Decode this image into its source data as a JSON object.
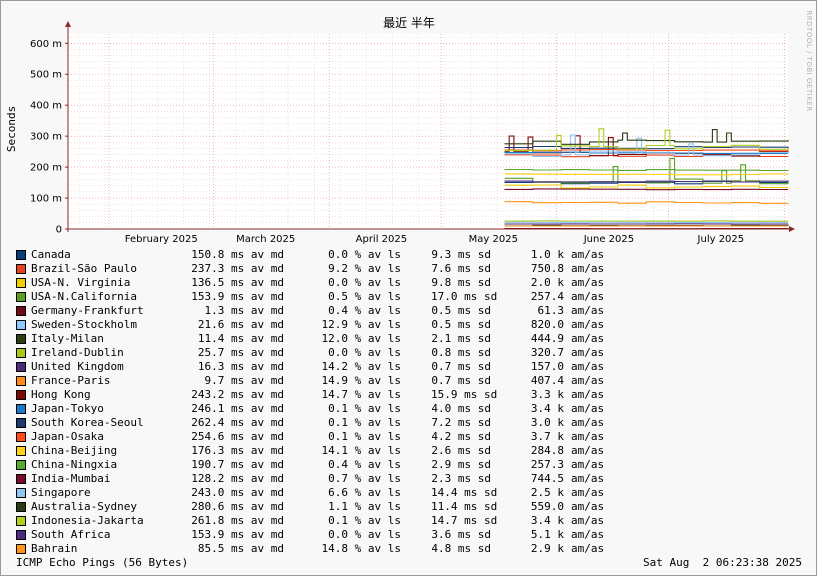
{
  "chart_data": {
    "type": "line",
    "title": "最近 半年",
    "ylabel": "Seconds",
    "ylim": [
      0,
      630
    ],
    "yticks": [
      {
        "value": 0,
        "label": "0"
      },
      {
        "value": 100,
        "label": "100 m"
      },
      {
        "value": 200,
        "label": "200 m"
      },
      {
        "value": 300,
        "label": "300 m"
      },
      {
        "value": 400,
        "label": "400 m"
      },
      {
        "value": 500,
        "label": "500 m"
      },
      {
        "value": 600,
        "label": "600 m"
      }
    ],
    "x_start": "2025-01-21",
    "x_end": "2025-08-02",
    "xticks": [
      {
        "date": "2025-02-15",
        "label": "February 2025"
      },
      {
        "date": "2025-03-15",
        "label": "March 2025"
      },
      {
        "date": "2025-04-15",
        "label": "April 2025"
      },
      {
        "date": "2025-05-15",
        "label": "May 2025"
      },
      {
        "date": "2025-06-15",
        "label": "June 2025"
      },
      {
        "date": "2025-07-15",
        "label": "July 2025"
      }
    ],
    "month_starts": [
      "2025-02-01",
      "2025-03-01",
      "2025-04-01",
      "2025-05-01",
      "2025-06-01",
      "2025-07-01",
      "2025-08-01"
    ],
    "data_start": "2025-05-18",
    "grid": true,
    "legend_position": "bottom",
    "series": [
      {
        "name": "Canada",
        "color": "#0a3d7c",
        "avg": "150.8 ms av md",
        "loss": "0.0 % av ls",
        "sd": "9.3 ms sd",
        "sent": "1.0 k",
        "unit": "am/as",
        "value": 150.8,
        "variation": 9.3
      },
      {
        "name": "Brazil-São Paulo",
        "color": "#e8421c",
        "avg": "237.3 ms av md",
        "loss": "9.2 % av ls",
        "sd": "7.6 ms sd",
        "sent": "750.8",
        "unit": "am/as",
        "value": 237.3,
        "variation": 7.6
      },
      {
        "name": "USA-N. Virginia",
        "color": "#f2d000",
        "avg": "136.5 ms av md",
        "loss": "0.0 % av ls",
        "sd": "9.8 ms sd",
        "sent": "2.0 k",
        "unit": "am/as",
        "value": 136.5,
        "variation": 9.8
      },
      {
        "name": "USA-N.California",
        "color": "#5a9e26",
        "avg": "153.9 ms av md",
        "loss": "0.5 % av ls",
        "sd": "17.0 ms sd",
        "sent": "257.4",
        "unit": "am/as",
        "value": 153.9,
        "variation": 17.0
      },
      {
        "name": "Germany-Frankfurt",
        "color": "#6e0b16",
        "avg": "1.3 ms av md",
        "loss": "0.4 % av ls",
        "sd": "0.5 ms sd",
        "sent": "61.3",
        "unit": "am/as",
        "value": 1.3,
        "variation": 0.5
      },
      {
        "name": "Sweden-Stockholm",
        "color": "#8cc8ff",
        "avg": "21.6 ms av md",
        "loss": "12.9 % av ls",
        "sd": "0.5 ms sd",
        "sent": "820.0",
        "unit": "am/as",
        "value": 21.6,
        "variation": 0.5
      },
      {
        "name": "Italy-Milan",
        "color": "#2e3c12",
        "avg": "11.4 ms av md",
        "loss": "12.0 % av ls",
        "sd": "2.1 ms sd",
        "sent": "444.9",
        "unit": "am/as",
        "value": 11.4,
        "variation": 2.1
      },
      {
        "name": "Ireland-Dublin",
        "color": "#a8c818",
        "avg": "25.7 ms av md",
        "loss": "0.0 % av ls",
        "sd": "0.8 ms sd",
        "sent": "320.7",
        "unit": "am/as",
        "value": 25.7,
        "variation": 0.8
      },
      {
        "name": "United Kingdom",
        "color": "#4a2a7a",
        "avg": "16.3 ms av md",
        "loss": "14.2 % av ls",
        "sd": "0.7 ms sd",
        "sent": "157.0",
        "unit": "am/as",
        "value": 16.3,
        "variation": 0.7
      },
      {
        "name": "France-Paris",
        "color": "#ff8c1a",
        "avg": "9.7 ms av md",
        "loss": "14.9 % av ls",
        "sd": "0.7 ms sd",
        "sent": "407.4",
        "unit": "am/as",
        "value": 9.7,
        "variation": 0.7
      },
      {
        "name": "Hong Kong",
        "color": "#7a0a0a",
        "avg": "243.2 ms av md",
        "loss": "14.7 % av ls",
        "sd": "15.9 ms sd",
        "sent": "3.3 k",
        "unit": "am/as",
        "value": 243.2,
        "variation": 15.9
      },
      {
        "name": "Japan-Tokyo",
        "color": "#1a7ac8",
        "avg": "246.1 ms av md",
        "loss": "0.1 % av ls",
        "sd": "4.0 ms sd",
        "sent": "3.4 k",
        "unit": "am/as",
        "value": 246.1,
        "variation": 4.0
      },
      {
        "name": "South Korea-Seoul",
        "color": "#1a3a6e",
        "avg": "262.4 ms av md",
        "loss": "0.1 % av ls",
        "sd": "7.2 ms sd",
        "sent": "3.0 k",
        "unit": "am/as",
        "value": 262.4,
        "variation": 7.2
      },
      {
        "name": "Japan-Osaka",
        "color": "#ff4a1a",
        "avg": "254.6 ms av md",
        "loss": "0.1 % av ls",
        "sd": "4.2 ms sd",
        "sent": "3.7 k",
        "unit": "am/as",
        "value": 254.6,
        "variation": 4.2
      },
      {
        "name": "China-Beijing",
        "color": "#ffd21a",
        "avg": "176.3 ms av md",
        "loss": "14.1 % av ls",
        "sd": "2.6 ms sd",
        "sent": "284.8",
        "unit": "am/as",
        "value": 176.3,
        "variation": 2.6
      },
      {
        "name": "China-Ningxia",
        "color": "#5aa832",
        "avg": "190.7 ms av md",
        "loss": "0.4 % av ls",
        "sd": "2.9 ms sd",
        "sent": "257.3",
        "unit": "am/as",
        "value": 190.7,
        "variation": 2.9
      },
      {
        "name": "India-Mumbai",
        "color": "#7a0a2a",
        "avg": "128.2 ms av md",
        "loss": "0.7 % av ls",
        "sd": "2.3 ms sd",
        "sent": "744.5",
        "unit": "am/as",
        "value": 128.2,
        "variation": 2.3
      },
      {
        "name": "Singapore",
        "color": "#8ec6f0",
        "avg": "243.0 ms av md",
        "loss": "6.6 % av ls",
        "sd": "14.4 ms sd",
        "sent": "2.5 k",
        "unit": "am/as",
        "value": 243.0,
        "variation": 14.4
      },
      {
        "name": "Australia-Sydney",
        "color": "#2a3a12",
        "avg": "280.6 ms av md",
        "loss": "1.1 % av ls",
        "sd": "11.4 ms sd",
        "sent": "559.0",
        "unit": "am/as",
        "value": 280.6,
        "variation": 11.4
      },
      {
        "name": "Indonesia-Jakarta",
        "color": "#b0d020",
        "avg": "261.8 ms av md",
        "loss": "0.1 % av ls",
        "sd": "14.7 ms sd",
        "sent": "3.4 k",
        "unit": "am/as",
        "value": 261.8,
        "variation": 14.7
      },
      {
        "name": "South Africa",
        "color": "#4a2a7e",
        "avg": "153.9 ms av md",
        "loss": "0.0 % av ls",
        "sd": "3.6 ms sd",
        "sent": "5.1 k",
        "unit": "am/as",
        "value": 153.9,
        "variation": 3.6
      },
      {
        "name": "Bahrain",
        "color": "#ff9418",
        "avg": "85.5 ms av md",
        "loss": "14.8 % av ls",
        "sd": "4.8 ms sd",
        "sent": "2.9 k",
        "unit": "am/as",
        "value": 85.5,
        "variation": 4.8
      }
    ]
  },
  "watermark": "RRDTOOL / TOBI OETIKER",
  "footer": {
    "left": "ICMP Echo Pings (56 Bytes)",
    "right": "Sat Aug  2 06:23:38 2025"
  }
}
